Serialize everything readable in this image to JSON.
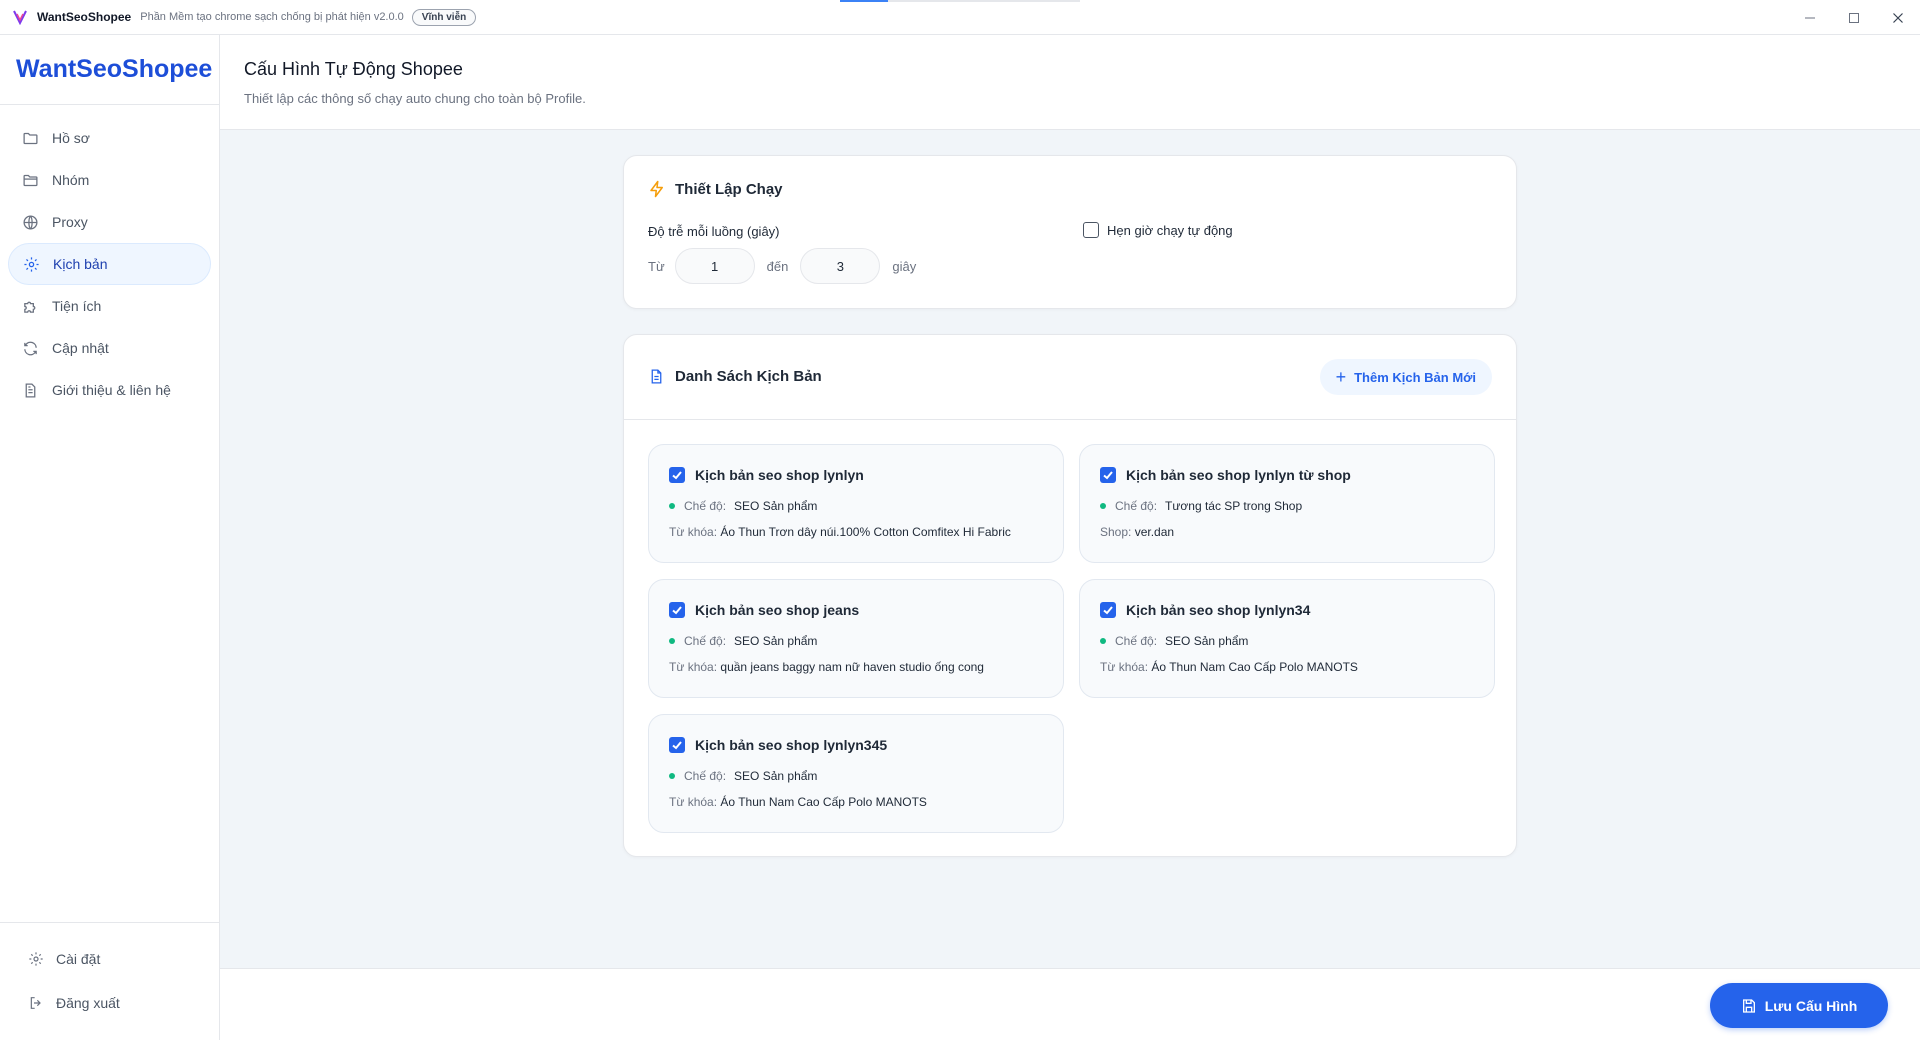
{
  "titlebar": {
    "app_name": "WantSeoShopee",
    "subtitle": "Phần Mềm tạo chrome sạch chống bị phát hiện v2.0.0",
    "badge": "Vĩnh viễn"
  },
  "sidebar": {
    "brand": "WantSeoShopee",
    "items": [
      {
        "label": "Hồ sơ",
        "icon": "folder-icon"
      },
      {
        "label": "Nhóm",
        "icon": "folder-open-icon"
      },
      {
        "label": "Proxy",
        "icon": "globe-icon"
      },
      {
        "label": "Kịch bản",
        "icon": "gear-icon",
        "active": true
      },
      {
        "label": "Tiện ích",
        "icon": "puzzle-icon"
      },
      {
        "label": "Cập nhật",
        "icon": "refresh-icon"
      },
      {
        "label": "Giới thiệu & liên hệ",
        "icon": "document-icon"
      }
    ],
    "bottom": {
      "settings_label": "Cài đặt",
      "logout_label": "Đăng xuất"
    }
  },
  "header": {
    "title": "Cấu Hình Tự Động Shopee",
    "description": "Thiết lập các thông số chạy auto chung cho toàn bộ Profile."
  },
  "run_settings": {
    "title": "Thiết Lập Chạy",
    "delay_label": "Độ trễ mỗi luồng (giây)",
    "from_label": "Từ",
    "from_value": "1",
    "to_label": "đến",
    "to_value": "3",
    "unit_label": "giây",
    "schedule_label": "Hẹn giờ chạy tự động",
    "schedule_checked": false
  },
  "scripts": {
    "title": "Danh Sách Kịch Bản",
    "add_button": "Thêm Kịch Bản Mới",
    "mode_key": "Chế độ:",
    "items": [
      {
        "name": "Kịch bản seo shop lynlyn",
        "mode": "SEO Sản phẩm",
        "meta_key": "Từ khóa:",
        "meta_value": "Áo Thun Trơn dây núi.100% Cotton Comfitex Hi Fabric",
        "checked": true
      },
      {
        "name": "Kịch bản seo shop lynlyn từ shop",
        "mode": "Tương tác SP trong Shop",
        "meta_key": "Shop:",
        "meta_value": "ver.dan",
        "checked": true
      },
      {
        "name": "Kịch bản seo shop jeans",
        "mode": "SEO Sản phẩm",
        "meta_key": "Từ khóa:",
        "meta_value": "quần jeans baggy nam nữ haven studio ống cong",
        "checked": true
      },
      {
        "name": "Kịch bản seo shop lynlyn34",
        "mode": "SEO Sản phẩm",
        "meta_key": "Từ khóa:",
        "meta_value": "Áo Thun Nam Cao Cấp Polo MANOTS",
        "checked": true
      },
      {
        "name": "Kịch bản seo shop lynlyn345",
        "mode": "SEO Sản phẩm",
        "meta_key": "Từ khóa:",
        "meta_value": "Áo Thun Nam Cao Cấp Polo MANOTS",
        "checked": true
      }
    ]
  },
  "footer": {
    "save_button": "Lưu Cấu Hình"
  },
  "colors": {
    "accent": "#2563eb",
    "brand": "#1d4ed8",
    "status_dot": "#10b981",
    "lightning": "#f59e0b"
  }
}
